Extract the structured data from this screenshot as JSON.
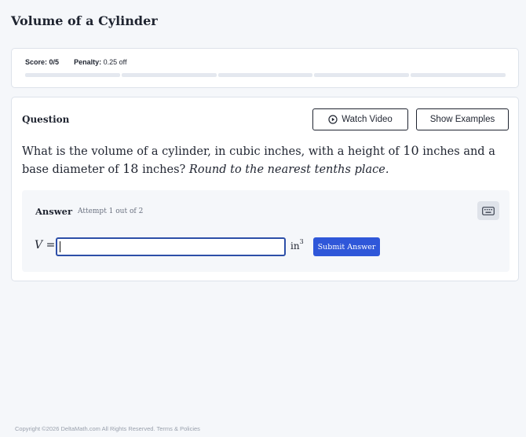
{
  "page": {
    "title": "Volume of a Cylinder"
  },
  "score": {
    "score_label": "Score:",
    "score_value": "0/5",
    "penalty_label": "Penalty:",
    "penalty_value": "0.25 off",
    "segments": 5,
    "completed": 0
  },
  "question": {
    "heading": "Question",
    "watch_video_label": "Watch Video",
    "show_examples_label": "Show Examples",
    "text_part1": "What is the volume of a cylinder, in cubic inches, with a height of ",
    "height": "10",
    "text_part2": " inches and a base diameter of ",
    "diameter": "18",
    "text_part3": " inches? ",
    "instruction": "Round to the nearest tenths place."
  },
  "answer": {
    "label": "Answer",
    "attempt": "Attempt 1 out of 2",
    "variable": "V",
    "equals": "=",
    "input_value": "",
    "unit": "in",
    "unit_exponent": "3",
    "submit_label": "Submit Answer"
  },
  "icons": {
    "watch": "play-circle-icon",
    "keyboard": "keyboard-icon"
  },
  "colors": {
    "accent": "#2f57d9",
    "input_border": "#2d4fa8",
    "background": "#f5f7fa"
  },
  "footer": {
    "copyright": "Copyright ©2026 DeltaMath.com All Rights Reserved.",
    "terms_link": "Terms & Policies"
  }
}
